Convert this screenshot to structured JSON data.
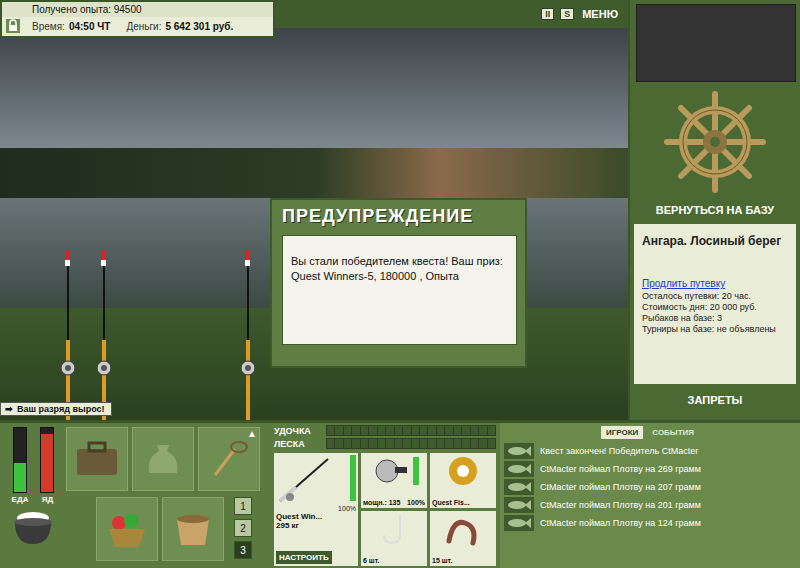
{
  "status": {
    "experience": "Получено опыта: 94500",
    "time_label": "Время:",
    "time": "04:50 ЧТ",
    "money_label": "Деньги:",
    "money": "5 642 301 руб."
  },
  "header": {
    "buttons": [
      "II",
      "S"
    ],
    "menu": "МЕНЮ"
  },
  "dialog": {
    "title": "ПРЕДУПРЕЖДЕНИЕ",
    "message": "Вы стали победителем квеста! Ваш приз: Quest Winners-5, 180000 , Опыта"
  },
  "rank_badge": "Ваш разряд вырос!",
  "base": {
    "button": "ВЕРНУТЬСЯ НА БАЗУ",
    "location": "Ангара. Лосиный берег",
    "extend_link": "Продлить путевку",
    "details": [
      "Осталось путевки: 20 час.",
      "Стоимость дня: 20 000 руб.",
      "Рыбаков на базе: 3",
      "Турниры на базе: не объявлены"
    ],
    "bans": "ЗАПРЕТЫ"
  },
  "meters": [
    {
      "label": "ЕДА",
      "level": 0.45,
      "color": "#3cc43c"
    },
    {
      "label": "ЯД",
      "level": 0.9,
      "color": "#d83a2a"
    }
  ],
  "inventory_arrow": "▲",
  "inventory_pages": [
    {
      "label": "1",
      "selected": false
    },
    {
      "label": "2",
      "selected": false
    },
    {
      "label": "3",
      "selected": true
    }
  ],
  "tackle": {
    "rod_label": "УДОЧКА",
    "rod_level": 0,
    "line_label": "ЛЕСКА",
    "line_level": 0,
    "rod": {
      "name": "Quest Win...",
      "weight": "295 кг",
      "condition": "100%",
      "level": 1,
      "button": "НАСТРОИТЬ"
    },
    "reel": {
      "power": "мощн.: 135",
      "condition": "100%",
      "level": 1
    },
    "line": {
      "name": "Quest Fis..."
    },
    "hook": {
      "count": "6 шт."
    },
    "bait": {
      "count": "15 шт."
    }
  },
  "chat": {
    "tabs": [
      {
        "label": "ИГРОКИ",
        "selected": true
      },
      {
        "label": "СОБЫТИЯ",
        "selected": false
      }
    ],
    "messages": [
      "Квест закончен! Победитель CtMacter",
      "CtMacter поймал Плотву на 269 грамм",
      "CtMacter поймал Плотву на 207 грамм",
      "CtMacter поймал Плотву на 201 грамм",
      "CtMacter поймал Плотву на 124 грамм"
    ]
  }
}
